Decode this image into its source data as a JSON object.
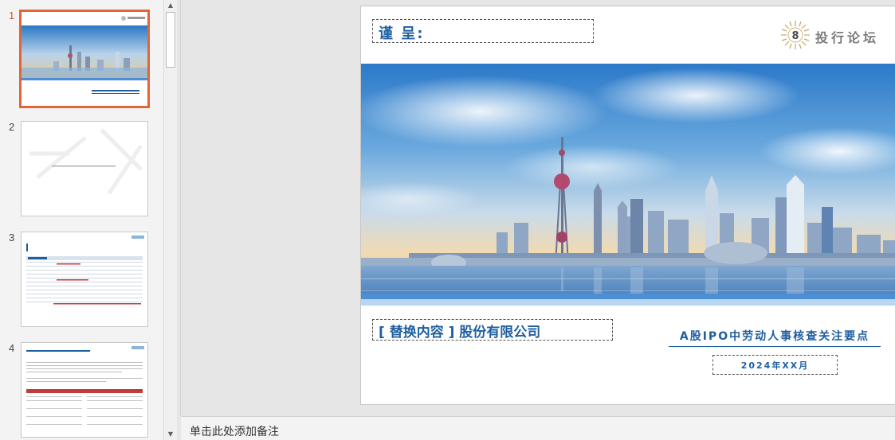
{
  "thumbnails": [
    {
      "number": "1"
    },
    {
      "number": "2"
    },
    {
      "number": "3"
    },
    {
      "number": "4"
    }
  ],
  "notes": {
    "placeholder": "单击此处添加备注"
  },
  "slide": {
    "reverent_label": "谨 呈:",
    "logo_text": "投行论坛",
    "logo_mark": "8",
    "company_name": "[ 替换内容 ] 股份有限公司",
    "title": "A股IPO中劳动人事核查关注要点",
    "date": "2024年XX月"
  },
  "colors": {
    "accent": "#1f5fa0",
    "selection": "#e0653b",
    "stripe": "#4c8fd6"
  }
}
